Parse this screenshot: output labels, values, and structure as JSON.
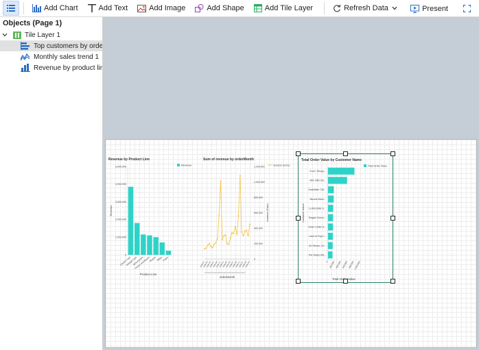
{
  "toolbar": {
    "add_chart": "Add Chart",
    "add_text": "Add Text",
    "add_image": "Add Image",
    "add_shape": "Add Shape",
    "add_tile_layer": "Add Tile Layer",
    "refresh_data": "Refresh Data",
    "present": "Present",
    "accent": "#2b6cc4"
  },
  "sidebar": {
    "title": "Objects (Page 1)",
    "layer": "Tile Layer 1",
    "items": [
      {
        "label": "Top customers by order",
        "icon": "bar-horizontal-icon",
        "selected": true
      },
      {
        "label": "Monthly sales trend 1",
        "icon": "line-chart-icon",
        "selected": false
      },
      {
        "label": "Revenue by product lin",
        "icon": "bar-vertical-icon",
        "selected": false
      }
    ]
  },
  "chart_data": [
    {
      "type": "bar",
      "title": "Revenue by Product Line",
      "xlabel": "Product Line",
      "ylabel": "Revenue",
      "legend": "Revenue",
      "legend_position": "top-right",
      "color": "#2ed3c8",
      "categories": [
        "Classic Cars",
        "Vintage Cars",
        "Motorcycles",
        "Trucks and Buses",
        "Planes",
        "Ships",
        "Trains"
      ],
      "values": [
        3850000,
        1800000,
        1150000,
        1100000,
        1000000,
        700000,
        230000
      ],
      "yticks": [
        "0",
        "1,000,000",
        "2,000,000",
        "3,000,000",
        "4,000,000",
        "5,000,000"
      ],
      "ylim": [
        0,
        5000000
      ]
    },
    {
      "type": "line",
      "title": "Sum of revenue by orderMonth",
      "xlabel": "orderMonth",
      "ylabel": "revenue (Sum)",
      "legend": "revenue (Sum)",
      "legend_position": "top-right",
      "color": "#f5c342",
      "x": [
        "2003-01",
        "2003-02",
        "2003-03",
        "2003-04",
        "2003-05",
        "2003-06",
        "2003-07",
        "2003-08",
        "2003-09",
        "2003-10",
        "2003-11",
        "2003-12",
        "2004-01",
        "2004-02",
        "2004-03",
        "2004-04",
        "2004-05",
        "2004-06",
        "2004-07",
        "2004-08",
        "2004-09",
        "2004-10",
        "2004-11",
        "2004-12",
        "2005-01",
        "2005-02",
        "2005-03",
        "2005-04",
        "2005-05"
      ],
      "values": [
        130000,
        140000,
        175000,
        200000,
        165000,
        145000,
        190000,
        210000,
        260000,
        570000,
        1010000,
        250000,
        300000,
        310000,
        200000,
        190000,
        270000,
        340000,
        330000,
        420000,
        320000,
        560000,
        1080000,
        350000,
        300000,
        360000,
        370000,
        300000,
        450000
      ],
      "yticks": [
        "0",
        "200,000",
        "400,000",
        "600,000",
        "800,000",
        "1,000,000",
        "1,200,000"
      ],
      "ylim": [
        0,
        1200000
      ]
    },
    {
      "type": "bar",
      "orientation": "horizontal",
      "title": "Total Order Value by Customer Name",
      "xlabel": "Total Order Value",
      "ylabel": "Customer Name",
      "legend": "Total Order Value",
      "legend_position": "top-right",
      "color": "#2ed3c8",
      "categories": [
        "Euro+ Shopp...",
        "Mini Gifts Dis...",
        "Australian Coll...",
        "Muscle Mach...",
        "La Rochelle G...",
        "Dragon Souve...",
        "Down Under S...",
        "Land of Toys I...",
        "AV Stores, Co...",
        "The Sharp Gift..."
      ],
      "values": [
        820000,
        590000,
        180000,
        175000,
        160000,
        155000,
        155000,
        150000,
        145000,
        140000
      ],
      "xticks": [
        "0",
        "200,000",
        "400,000",
        "600,000",
        "800,000",
        "1,000,000"
      ],
      "xlim": [
        0,
        1000000
      ]
    }
  ]
}
